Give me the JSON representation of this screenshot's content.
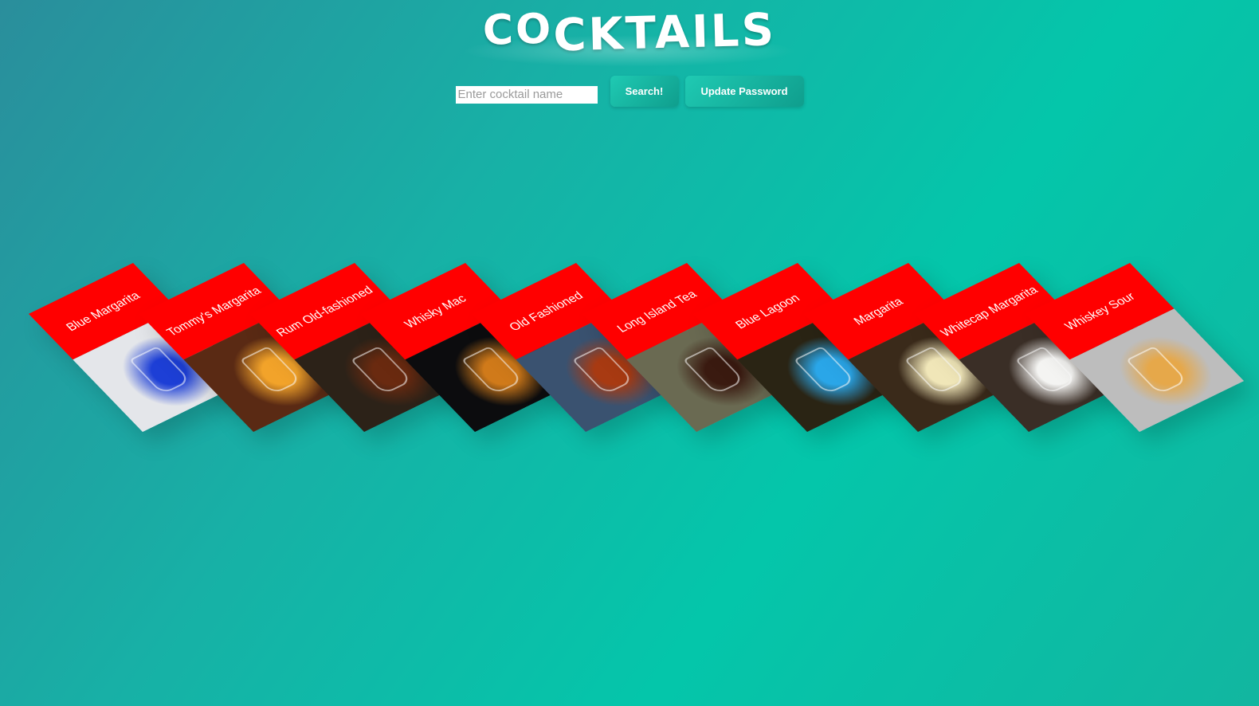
{
  "header": {
    "title_prefix": "CO",
    "title_rest": "CKTAILS"
  },
  "search": {
    "placeholder": "Enter cocktail name",
    "value": "",
    "search_label": "Search!",
    "update_password_label": "Update Password"
  },
  "cocktails": [
    {
      "name": "Blue Margarita",
      "photo_bg": "#e4e6ea",
      "drink": "#1d3fd6"
    },
    {
      "name": "Tommy's Margarita",
      "photo_bg": "#5a2a14",
      "drink": "#f2a32a"
    },
    {
      "name": "Rum Old-fashioned",
      "photo_bg": "#2c2218",
      "drink": "#6a2a10"
    },
    {
      "name": "Whisky Mac",
      "photo_bg": "#0c0c0e",
      "drink": "#d07a1a"
    },
    {
      "name": "Old Fashioned",
      "photo_bg": "#3a5270",
      "drink": "#a83a12"
    },
    {
      "name": "Long Island Tea",
      "photo_bg": "#6a6a52",
      "drink": "#3a1a10"
    },
    {
      "name": "Blue Lagoon",
      "photo_bg": "#2a2414",
      "drink": "#2aa6e8"
    },
    {
      "name": "Margarita",
      "photo_bg": "#3a2a1a",
      "drink": "#f0e6b8"
    },
    {
      "name": "Whitecap Margarita",
      "photo_bg": "#3a2e26",
      "drink": "#f4f4f2"
    },
    {
      "name": "Whiskey Sour",
      "photo_bg": "#bdbdbd",
      "drink": "#e6a84a"
    }
  ],
  "colors": {
    "card_label": "#ff0000",
    "button": "#14b09e",
    "background": "#0cc2a8"
  }
}
